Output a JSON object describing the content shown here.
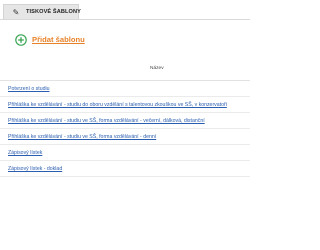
{
  "header": {
    "tab_label": "TISKOVÉ ŠABLONY",
    "tab_icon": "edit-icon"
  },
  "actions": {
    "add_label": "Přidat šablonu",
    "add_icon": "plus-circle-icon",
    "add_color": "#e8822a",
    "icon_color": "#3aa655"
  },
  "table": {
    "column_name": "Název",
    "rows": [
      "Potvrzení o studiu",
      "Přihláška ke vzdělávání - studiu do oboru vzdělání s talentovou zkouškou ve SŠ, v konzervatoři",
      "Přihláška ke vzdělávání - studiu ve SŠ, forma vzdělávání - večerní, dálková, distanční",
      "Přihláška ke vzdělávání - studiu ve SŠ, forma vzdělávání - denní",
      "Zápisový lístek",
      "Zápisový lístek - doklad"
    ],
    "link_color": "#2a5db0"
  }
}
